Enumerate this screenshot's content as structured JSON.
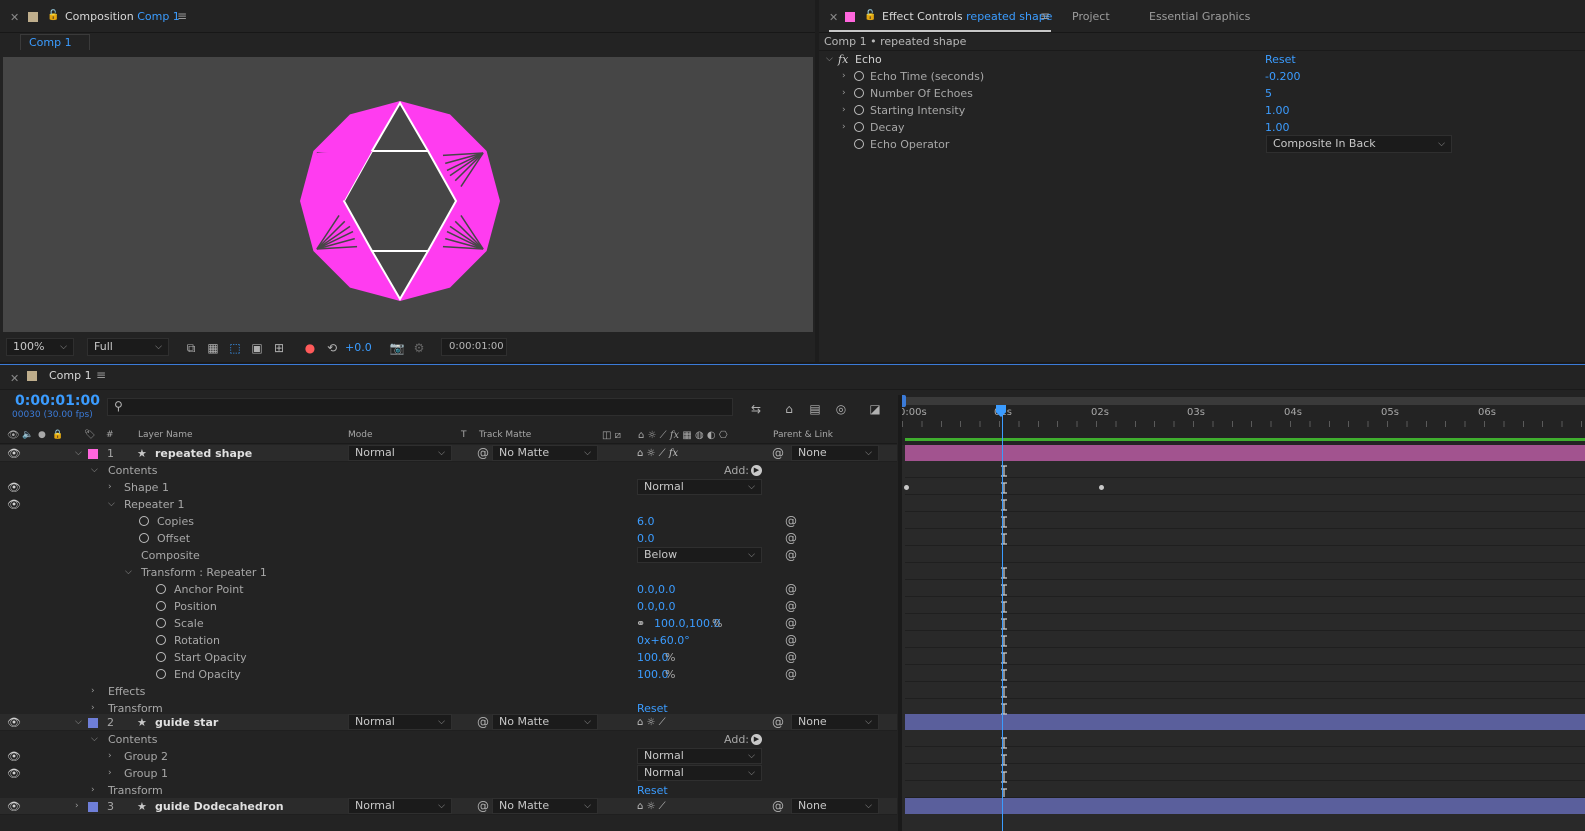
{
  "composition_panel": {
    "tab_title": "Composition",
    "tab_comp": "Comp 1",
    "sub_tab": "Comp 1",
    "zoom": "100%",
    "resolution": "Full",
    "exposure": "+0.0",
    "timecode": "0:00:01:00",
    "colors": {
      "accent": "#3b9cff",
      "shape_magenta": "#ff3cf0",
      "viewer_bg": "#464646"
    }
  },
  "effect_controls": {
    "tab_title": "Effect Controls",
    "tab_layer": "repeated shape",
    "tab_project": "Project",
    "tab_essential": "Essential Graphics",
    "breadcrumb": "Comp 1 • repeated shape",
    "effect_name": "Echo",
    "reset_label": "Reset",
    "properties": [
      {
        "name": "Echo Time (seconds)",
        "value": "-0.200"
      },
      {
        "name": "Number Of Echoes",
        "value": "5"
      },
      {
        "name": "Starting Intensity",
        "value": "1.00"
      },
      {
        "name": "Decay",
        "value": "1.00"
      },
      {
        "name": "Echo Operator",
        "value": "Composite In Back"
      }
    ]
  },
  "timeline": {
    "tab_comp": "Comp 1",
    "current_time": "0:00:01:00",
    "frame_info": "00030 (30.00 fps)",
    "search_placeholder": "",
    "headers": {
      "num": "#",
      "layer_name": "Layer Name",
      "mode": "Mode",
      "t": "T",
      "track_matte": "Track Matte",
      "parent": "Parent & Link"
    },
    "ruler": [
      "0:00s",
      "01s",
      "02s",
      "03s",
      "04s",
      "05s",
      "06s"
    ],
    "layers": [
      {
        "num": "1",
        "name": "repeated shape",
        "mode": "Normal",
        "matte": "No Matte",
        "parent": "None",
        "color": "#ff66dd"
      },
      {
        "num": "2",
        "name": "guide star",
        "mode": "Normal",
        "matte": "No Matte",
        "parent": "None",
        "color": "#6f7fd8"
      },
      {
        "num": "3",
        "name": "guide Dodecahedron",
        "mode": "Normal",
        "matte": "No Matte",
        "parent": "None",
        "color": "#6f7fd8"
      }
    ],
    "rows": {
      "contents": "Contents",
      "add": "Add:",
      "shape1": "Shape 1",
      "shape1_mode": "Normal",
      "repeater1": "Repeater 1",
      "copies": "Copies",
      "copies_val": "6.0",
      "offset": "Offset",
      "offset_val": "0.0",
      "composite": "Composite",
      "composite_val": "Below",
      "transform_repeater": "Transform : Repeater 1",
      "anchor": "Anchor Point",
      "anchor_val": "0.0,0.0",
      "position": "Position",
      "position_val": "0.0,0.0",
      "scale": "Scale",
      "scale_val": "100.0,100.0",
      "scale_unit": "%",
      "rotation": "Rotation",
      "rotation_val": "0x+60.0°",
      "start_opacity": "Start Opacity",
      "start_opacity_val": "100.0",
      "end_opacity": "End Opacity",
      "end_opacity_val": "100.0",
      "pct": "%",
      "effects": "Effects",
      "transform": "Transform",
      "reset": "Reset",
      "group2": "Group 2",
      "group1": "Group 1",
      "group_mode": "Normal"
    },
    "colors": {
      "layer1_bar": "#a2538f",
      "layer2_bar": "#5a5f9c",
      "work_area": "#3fae2e",
      "playhead": "#3b9cff"
    }
  }
}
